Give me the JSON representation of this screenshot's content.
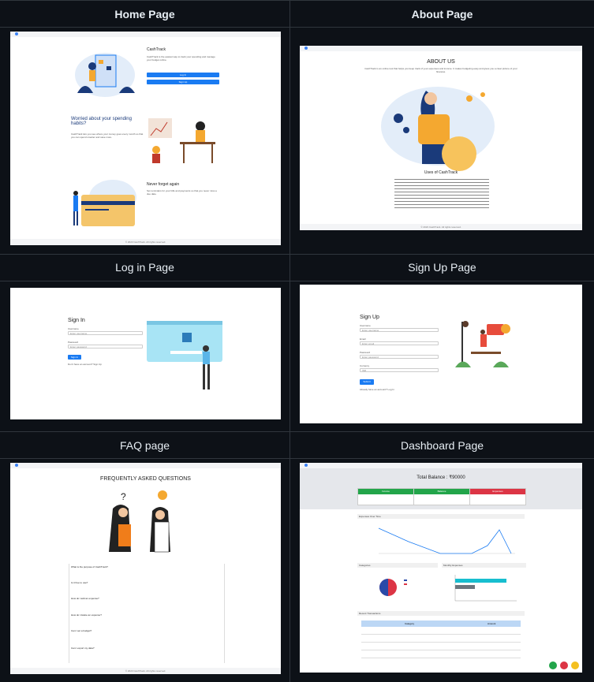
{
  "sections": {
    "home": "Home Page",
    "about": "About Page",
    "login": "Log in Page",
    "signup": "Sign Up Page",
    "faq": "FAQ page",
    "dashboard": "Dashboard Page"
  },
  "home": {
    "hero_title": "CashTrack",
    "hero_text": "CashTrack is the easiest way to track your spending and manage your budget online.",
    "btn_login": "Log In",
    "btn_signup": "Sign Up",
    "worried_title": "Worried about your spending habits?",
    "worried_text": "CashTrack lets you see where your money goes every month so that you can spend smarter and save more.",
    "never_title": "Never forget again",
    "never_text": "Set reminders for your bills and payments so that you never miss a due date.",
    "footer": "© 2023 CashTrack. All rights reserved."
  },
  "about": {
    "title": "ABOUT US",
    "text": "CashTrack is an online tool that helps you keep track of your expenses and income. It makes budgeting easy and gives you a clear picture of your finances.",
    "uses_title": "Uses of CashTrack",
    "footer": "© 2023 CashTrack. All rights reserved."
  },
  "login": {
    "title": "Sign In",
    "username_label": "Username",
    "username_placeholder": "Enter username",
    "password_label": "Password",
    "password_placeholder": "Enter password",
    "button": "Sign In",
    "link": "Don't have an account? Sign Up"
  },
  "signup": {
    "title": "Sign Up",
    "name_label": "Username",
    "name_placeholder": "Enter username",
    "email_label": "Email",
    "email_placeholder": "Enter email",
    "password_label": "Password",
    "password_placeholder": "Enter password",
    "currency_label": "Currency",
    "currency_value": "INR",
    "button": "Submit",
    "link": "Already have an account? Log In"
  },
  "faq": {
    "title": "FREQUENTLY ASKED QUESTIONS",
    "q1": "What is the purpose of CashTrack?",
    "q2": "Is it free to use?",
    "q3": "How do I add an expense?",
    "q4": "How do I delete an expense?",
    "q5": "Can I set a budget?",
    "q6": "Can I export my data?",
    "footer": "© 2023 CashTrack. All rights reserved."
  },
  "dashboard": {
    "balance_label": "Total Balance : ₹90000",
    "card1": "Income",
    "card2": "Balance",
    "card3": "Expenses",
    "section_line": "Expenses Over Time",
    "section_pie": "Categories",
    "section_bar": "Monthly Expenses",
    "section_table": "Recent Transactions",
    "table_header_1": "Category",
    "table_header_2": "Amount"
  },
  "colors": {
    "accent": "#1a7bf2",
    "green": "#22a54a",
    "red": "#dc3545",
    "cyan": "#17becf",
    "orange": "#f4a830"
  }
}
